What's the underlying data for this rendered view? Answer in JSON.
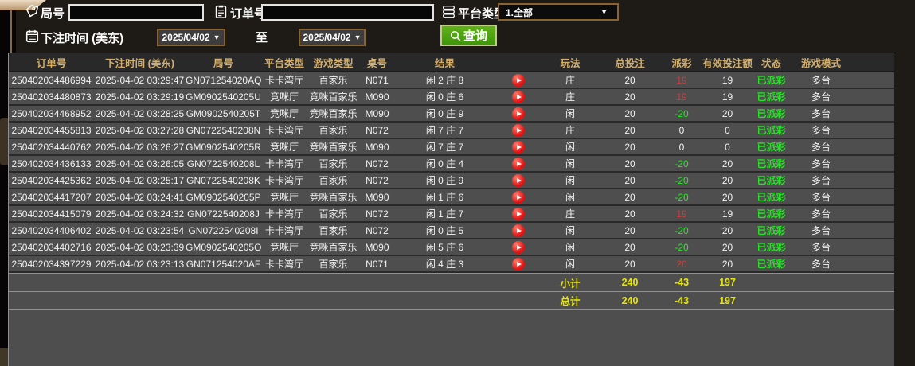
{
  "filters": {
    "round_label": "局号",
    "round_value": "",
    "order_label": "订单号",
    "order_value": "",
    "platform_label": "平台类型",
    "platform_value": "1.全部",
    "bet_time_label": "下注时间 (美东)",
    "date_from": "2025/04/02",
    "to_label": "至",
    "date_to": "2025/04/02",
    "query_label": "查询",
    "dropdown_arrow": "▼"
  },
  "colors": {
    "accent_border": "#8a6330",
    "query_green": "#4f9e10",
    "header_text": "#d2ae6e",
    "payout_win_red": "#d23c3c",
    "payout_loss_green": "#2ee62e",
    "status_green": "#24e624",
    "summary_yellow": "#e6e60a",
    "row_bg": "#4e4e4e"
  },
  "table": {
    "headers": [
      "订单号",
      "下注时间 (美东)",
      "局号",
      "平台类型",
      "游戏类型",
      "桌号",
      "结果",
      "",
      "玩法",
      "总投注",
      "派彩",
      "有效投注额",
      "状态",
      "游戏模式",
      ""
    ],
    "rows": [
      {
        "order": "250402034486994",
        "time": "2025-04-02 03:29:47",
        "round": "GN071254020AQ",
        "platform": "卡卡湾厅",
        "game": "百家乐",
        "table": "N071",
        "result": "闲 2 庄 8",
        "play_type": "庄",
        "total_bet": "20",
        "payout": "19",
        "payout_color": "red",
        "valid_bet": "19",
        "status": "已派彩",
        "mode": "多台"
      },
      {
        "order": "250402034480873",
        "time": "2025-04-02 03:29:19",
        "round": "GM0902540205U",
        "platform": "竞咪厅",
        "game": "竞咪百家乐",
        "table": "M090",
        "result": "闲 0 庄 6",
        "play_type": "庄",
        "total_bet": "20",
        "payout": "19",
        "payout_color": "red",
        "valid_bet": "19",
        "status": "已派彩",
        "mode": "多台"
      },
      {
        "order": "250402034468952",
        "time": "2025-04-02 03:28:25",
        "round": "GM0902540205T",
        "platform": "竞咪厅",
        "game": "竞咪百家乐",
        "table": "M090",
        "result": "闲 0 庄 9",
        "play_type": "闲",
        "total_bet": "20",
        "payout": "-20",
        "payout_color": "green",
        "valid_bet": "20",
        "status": "已派彩",
        "mode": "多台"
      },
      {
        "order": "250402034455813",
        "time": "2025-04-02 03:27:28",
        "round": "GN0722540208N",
        "platform": "卡卡湾厅",
        "game": "百家乐",
        "table": "N072",
        "result": "闲 7 庄 7",
        "play_type": "庄",
        "total_bet": "20",
        "payout": "0",
        "payout_color": "neutral",
        "valid_bet": "0",
        "status": "已派彩",
        "mode": "多台"
      },
      {
        "order": "250402034440762",
        "time": "2025-04-02 03:26:27",
        "round": "GM0902540205R",
        "platform": "竞咪厅",
        "game": "竞咪百家乐",
        "table": "M090",
        "result": "闲 7 庄 7",
        "play_type": "闲",
        "total_bet": "20",
        "payout": "0",
        "payout_color": "neutral",
        "valid_bet": "0",
        "status": "已派彩",
        "mode": "多台"
      },
      {
        "order": "250402034436133",
        "time": "2025-04-02 03:26:05",
        "round": "GN0722540208L",
        "platform": "卡卡湾厅",
        "game": "百家乐",
        "table": "N072",
        "result": "闲 0 庄 4",
        "play_type": "闲",
        "total_bet": "20",
        "payout": "-20",
        "payout_color": "green",
        "valid_bet": "20",
        "status": "已派彩",
        "mode": "多台"
      },
      {
        "order": "250402034425362",
        "time": "2025-04-02 03:25:17",
        "round": "GN0722540208K",
        "platform": "卡卡湾厅",
        "game": "百家乐",
        "table": "N072",
        "result": "闲 0 庄 9",
        "play_type": "闲",
        "total_bet": "20",
        "payout": "-20",
        "payout_color": "green",
        "valid_bet": "20",
        "status": "已派彩",
        "mode": "多台"
      },
      {
        "order": "250402034417207",
        "time": "2025-04-02 03:24:41",
        "round": "GM0902540205P",
        "platform": "竞咪厅",
        "game": "竞咪百家乐",
        "table": "M090",
        "result": "闲 1 庄 6",
        "play_type": "闲",
        "total_bet": "20",
        "payout": "-20",
        "payout_color": "green",
        "valid_bet": "20",
        "status": "已派彩",
        "mode": "多台"
      },
      {
        "order": "250402034415079",
        "time": "2025-04-02 03:24:32",
        "round": "GN0722540208J",
        "platform": "卡卡湾厅",
        "game": "百家乐",
        "table": "N072",
        "result": "闲 1 庄 7",
        "play_type": "庄",
        "total_bet": "20",
        "payout": "19",
        "payout_color": "red",
        "valid_bet": "19",
        "status": "已派彩",
        "mode": "多台"
      },
      {
        "order": "250402034406402",
        "time": "2025-04-02 03:23:54",
        "round": "GN0722540208I",
        "platform": "卡卡湾厅",
        "game": "百家乐",
        "table": "N072",
        "result": "闲 0 庄 5",
        "play_type": "闲",
        "total_bet": "20",
        "payout": "-20",
        "payout_color": "green",
        "valid_bet": "20",
        "status": "已派彩",
        "mode": "多台"
      },
      {
        "order": "250402034402716",
        "time": "2025-04-02 03:23:39",
        "round": "GM0902540205O",
        "platform": "竞咪厅",
        "game": "竞咪百家乐",
        "table": "M090",
        "result": "闲 5 庄 6",
        "play_type": "闲",
        "total_bet": "20",
        "payout": "-20",
        "payout_color": "green",
        "valid_bet": "20",
        "status": "已派彩",
        "mode": "多台"
      },
      {
        "order": "250402034397229",
        "time": "2025-04-02 03:23:13",
        "round": "GN071254020AF",
        "platform": "卡卡湾厅",
        "game": "百家乐",
        "table": "N071",
        "result": "闲 4 庄 3",
        "play_type": "闲",
        "total_bet": "20",
        "payout": "20",
        "payout_color": "red",
        "valid_bet": "20",
        "status": "已派彩",
        "mode": "多台"
      }
    ],
    "summary": [
      {
        "label": "小计",
        "total_bet": "240",
        "payout": "-43",
        "valid_bet": "197"
      },
      {
        "label": "总计",
        "total_bet": "240",
        "payout": "-43",
        "valid_bet": "197"
      }
    ]
  }
}
